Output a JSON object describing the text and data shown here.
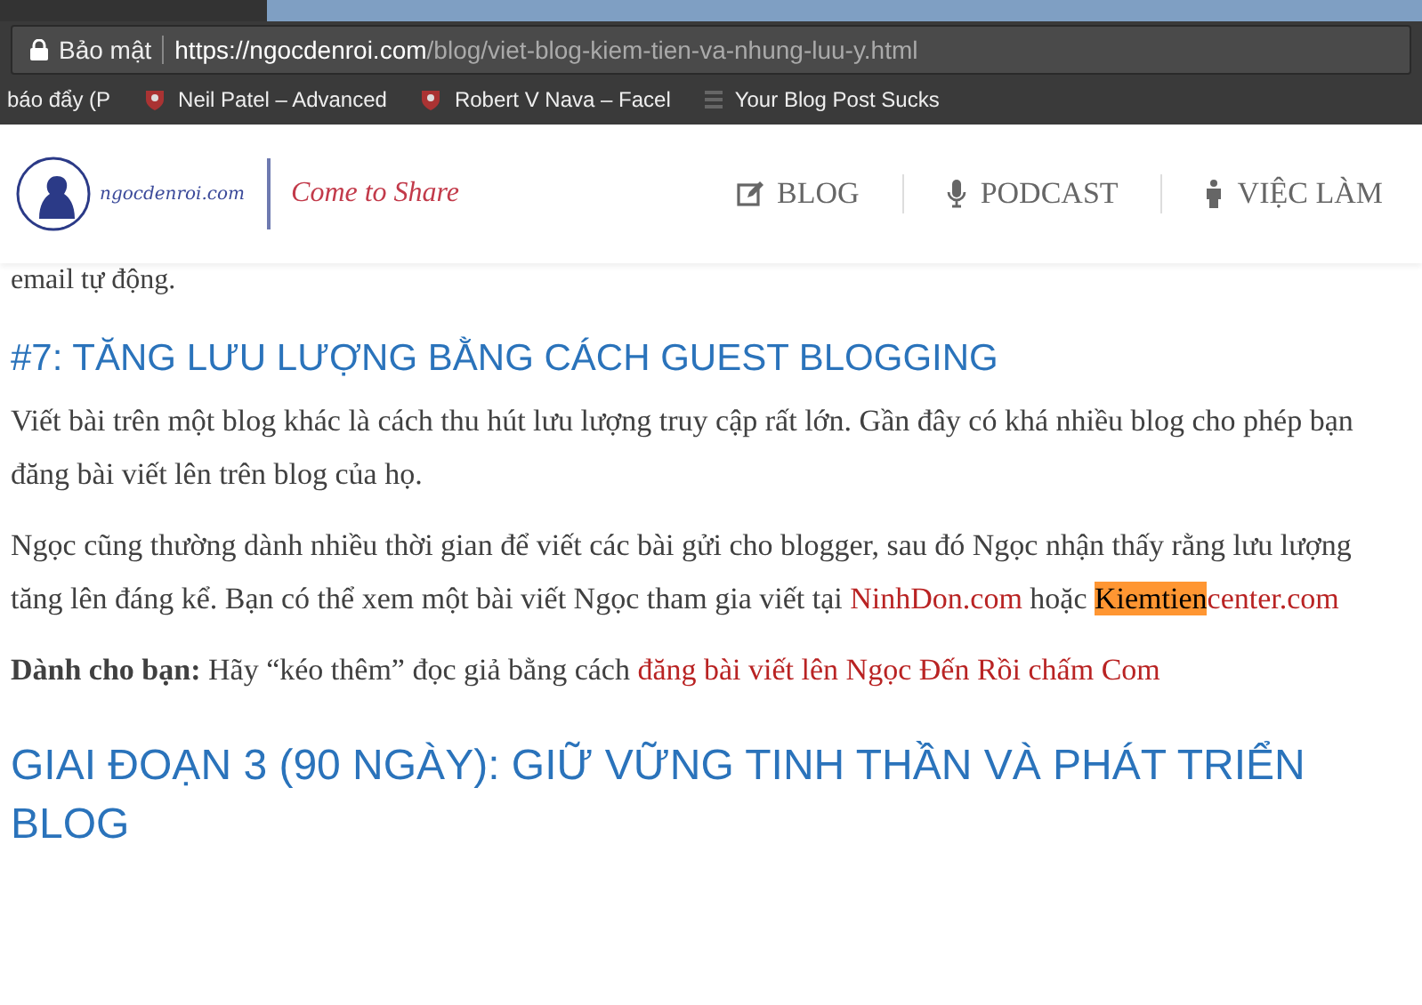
{
  "browser": {
    "security_label": "Bảo mật",
    "url_host": "https://ngocdenroi.com",
    "url_path": "/blog/viet-blog-kiem-tien-va-nhung-luu-y.html",
    "bookmarks": [
      {
        "label": "báo đẩy (P",
        "kind": "plain"
      },
      {
        "label": "Neil Patel – Advanced",
        "kind": "shield"
      },
      {
        "label": "Robert V Nava – Facel",
        "kind": "shield"
      },
      {
        "label": "Your Blog Post Sucks",
        "kind": "page"
      }
    ]
  },
  "site": {
    "logo_text": "ngocdenroi.com",
    "tagline": "Come to Share",
    "nav": [
      {
        "label": "BLOG",
        "kind": "edit"
      },
      {
        "label": "PODCAST",
        "kind": "mic"
      },
      {
        "label": "VIỆC LÀM",
        "kind": "person"
      }
    ]
  },
  "article": {
    "cut_line": "email tự động.",
    "heading_1": "#7: TĂNG LƯU LƯỢNG BẰNG CÁCH GUEST BLOGGING",
    "paragraph_1": "Viết bài trên một blog khác là cách thu hút lưu lượng truy cập rất lớn. Gần đây có khá nhiều blog cho phép bạn đăng bài viết lên trên blog của họ.",
    "paragraph_2": "Ngọc cũng thường dành nhiều thời gian để viết các bài gửi cho blogger, sau đó Ngọc nhận thấy rằng lưu lượng tăng lên đáng kể. Bạn có thể xem một bài viết Ngọc tham gia viết tại ",
    "link_1": "NinhDon.com",
    "between": " hoặc ",
    "link_2_highlighted": "Kiemtien",
    "link_2_rest": "center.com",
    "tip": "**Dành cho bạn:** Hãy “kéo thêm” đọc giả bằng cách ",
    "tip_link": "đăng bài viết lên Ngọc Đến Rồi chấm Com",
    "heading_2": "GIAI ĐOẠN 3 (90 NGÀY): GIỮ VỮNG TINH THẦN VÀ PHÁT TRIỂN BLOG"
  }
}
